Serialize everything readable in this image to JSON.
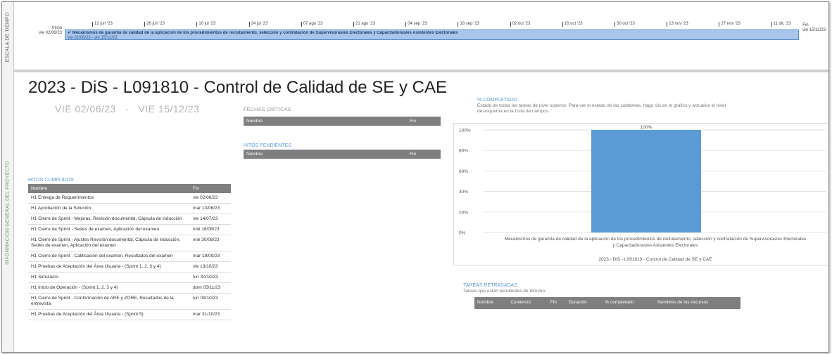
{
  "sidebar": {
    "timeline_label": "ESCALA DE TIEMPO",
    "info_label": "INFORMACIÓN GENERAL DEL PROYECTO"
  },
  "timeline": {
    "start_label": "Inicio",
    "start_date": "vie 02/06/23",
    "end_label": "Fin",
    "end_date": "vie 15/12/23",
    "ticks": [
      "12 jun '23",
      "26 jun '23",
      "10 jul '23",
      "24 jul '23",
      "07 ago '23",
      "21 ago '23",
      "04 sep '23",
      "18 sep '23",
      "02 oct '23",
      "16 oct '23",
      "30 oct '23",
      "13 nov '23",
      "27 nov '23",
      "11 dic '23"
    ],
    "bar_name": "Mecanismos de garantía de calidad de la aplicación de los procedimientos de reclutamiento, selección y contratación de Supervisoras/es Electorales y Capacitadoras/es Asistentes Electorales",
    "bar_dates": "vie 02/06/23 - vie 15/12/23"
  },
  "project": {
    "title": "2023 - DiS - L091810 - Control de Calidad de SE y CAE",
    "dates": "VIE 02/06/23   -   VIE 15/12/23"
  },
  "fechas_criticas": {
    "title": "FECHAS CRÍTICAS",
    "col_name": "Nombre",
    "col_fin": "Fin"
  },
  "hitos_pendientes": {
    "title": "HITOS PENDIENTES",
    "col_name": "Nombre",
    "col_fin": "Fin"
  },
  "hitos_cumplidos": {
    "title": "HITOS CUMPLIDOS",
    "col_name": "Nombre",
    "col_fin": "Fin",
    "rows": [
      {
        "name": "H1 Entrega de Requerimientos",
        "fin": "vie 02/06/23"
      },
      {
        "name": "H1 Aprobación de la Solución",
        "fin": "mar 13/06/23"
      },
      {
        "name": "H1 Cierre de Sprint - Mejoras, Revisión documental, Cápsula de inducción",
        "fin": "vie 14/07/23"
      },
      {
        "name": "H1 Cierre de Sprint - Sedes de examen, Aplicación del examen",
        "fin": "mié 16/08/23"
      },
      {
        "name": "H1 Cierre de Sprint - Ajustes Revisión documental, Cápsula de inducción, Sedes de examen, Aplicación del examen",
        "fin": "mié 30/08/23"
      },
      {
        "name": "H1 Cierre de Sprint - Calificación del examen, Resultados del examen",
        "fin": "mar 19/09/23"
      },
      {
        "name": "H1 Pruebas de Aceptación del Área Usuaria - (Sprint 1, 2, 3 y 4)",
        "fin": "vie 13/10/23"
      },
      {
        "name": "H1 Simulacro",
        "fin": "lun 30/10/23"
      },
      {
        "name": "H1 Inicio de Operación - (Sprint 1, 2, 3 y 4)",
        "fin": "dom 05/11/23"
      },
      {
        "name": "H1 Cierre de Sprint - Conformación de ARE y ZORE, Resultados de la entrevista",
        "fin": "lun 09/10/23"
      },
      {
        "name": "H1 Pruebas de Aceptación del Área Usuaria - (Sprint 5)",
        "fin": "mar 31/10/23"
      }
    ]
  },
  "pct_completado": {
    "title": "% COMPLETADO",
    "description": "Estado de todas las tareas de nivel superior. Para ver el estado de las subtareas, haga clic en el gráfico y actualice el nivel de esquema en la Lista de campos."
  },
  "chart_data": {
    "type": "bar",
    "categories": [
      "Mecanismos de garantía de calidad de la aplicación de los procedimientos de reclutamiento, selección y contratación de Supervisoras/es Electorales y Capacitadoras/es Asistentes Electorales"
    ],
    "category_lines": [
      "Mecanismos de garantía de calidad de la aplicación de los procedimientos de reclutamiento, selección y contratación de Supervisoras/es Electorales",
      "y Capacitadoras/es Asistentes Electorales"
    ],
    "values": [
      100
    ],
    "value_labels": [
      "100%"
    ],
    "xlabel": "2023 - DiS - L091810 - Control de Calidad de SE y CAE",
    "ylim": [
      0,
      100
    ],
    "yticks": [
      "0%",
      "20%",
      "40%",
      "60%",
      "80%",
      "100%"
    ],
    "grid": true,
    "bar_color": "#5b9bd5"
  },
  "tareas_retrasadas": {
    "title": "TAREAS RETRASADAS",
    "description": "Tareas que están pendientes de término.",
    "columns": [
      "Nombre",
      "Comienzo",
      "Fin",
      "Duración",
      "% completado",
      "Nombres de los recursos"
    ]
  }
}
